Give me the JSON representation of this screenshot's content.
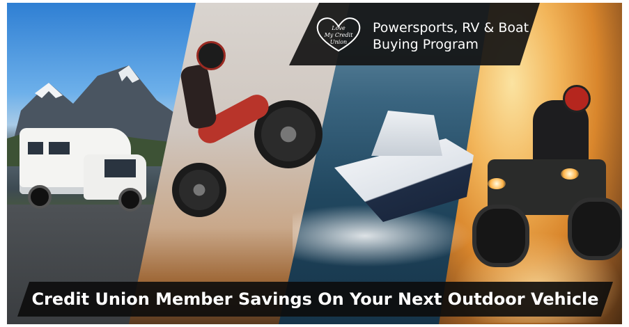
{
  "badge": {
    "logo_text": "LOVE MY CREDIT UNION",
    "program_line1": "Powersports, RV & Boat",
    "program_line2": "Buying Program"
  },
  "headline": {
    "text": "Credit Union Member Savings On Your Next Outdoor Vehicle"
  },
  "panels": [
    {
      "subject": "rv-mountains"
    },
    {
      "subject": "dirt-bike"
    },
    {
      "subject": "speed-boat"
    },
    {
      "subject": "atv"
    }
  ],
  "colors": {
    "overlay": "#141414",
    "text": "#ffffff",
    "sky": "#2f7fd3",
    "sunset": "#f2b55a"
  }
}
